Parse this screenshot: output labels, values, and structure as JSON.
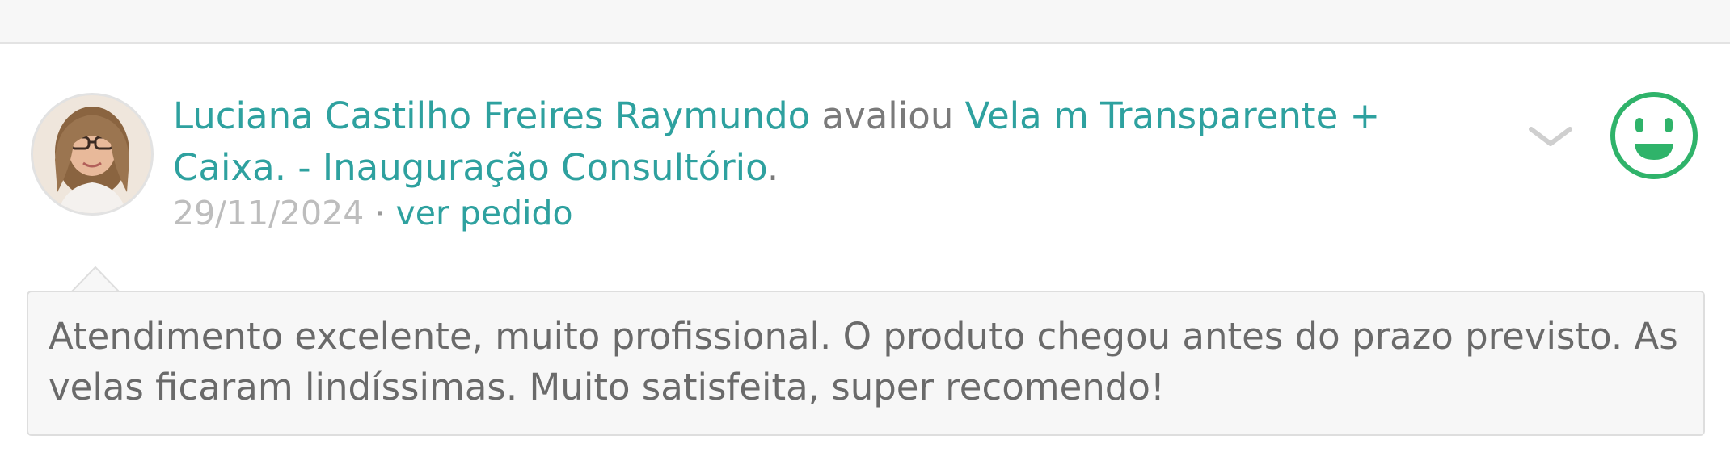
{
  "review": {
    "author_name": "Luciana Castilho Freires Raymundo",
    "verb": "avaliou",
    "product_title": "Vela m Transparente + Caixa. - Inauguração Consultório",
    "trailing_period": ".",
    "date": "29/11/2024",
    "separator": "·",
    "view_order_link": "ver pedido",
    "comment": "Atendimento excelente, muito profissional. O produto chegou antes do prazo previsto. As velas ficaram lindíssimas. Muito satisfeita, super recomendo!",
    "rating_icon": "happy-face-icon",
    "expand_icon": "chevron-down-icon"
  },
  "colors": {
    "accent": "#2ea19f",
    "smiley": "#2fb36a",
    "text_muted": "#7a7a7a",
    "date": "#bdbdbd",
    "comment_bg": "#f7f7f7",
    "comment_text": "#6a6a6a"
  }
}
